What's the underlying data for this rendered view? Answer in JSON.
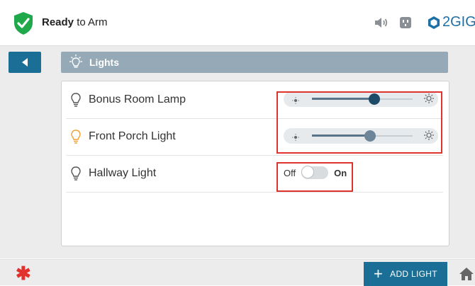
{
  "header": {
    "status_strong": "Ready",
    "status_rest": " to Arm",
    "brand": "2GIG",
    "icons": [
      "shield-check-icon",
      "moon-icon",
      "speaker-icon",
      "outlet-icon",
      "2gig-logo-icon"
    ]
  },
  "page": {
    "title": "Lights",
    "back_icon": "back-arrow-icon"
  },
  "lights": [
    {
      "name": "Bonus Room Lamp",
      "control": "dimmer",
      "level": 0.62,
      "on": true,
      "bulb_color": "#555555"
    },
    {
      "name": "Front Porch Light",
      "control": "dimmer",
      "level": 0.58,
      "on": true,
      "bulb_color": "#f0a030"
    },
    {
      "name": "Hallway Light",
      "control": "switch",
      "off_label": "Off",
      "on_label": "On",
      "on": false,
      "bulb_color": "#555555"
    }
  ],
  "footer": {
    "add_label": "ADD LIGHT",
    "star_icon": "asterisk-icon",
    "home_icon": "home-icon"
  },
  "colors": {
    "accent": "#1b6e96",
    "titlebar": "#95a9b6",
    "highlight": "#e0332f",
    "shield": "#1fa94b"
  }
}
